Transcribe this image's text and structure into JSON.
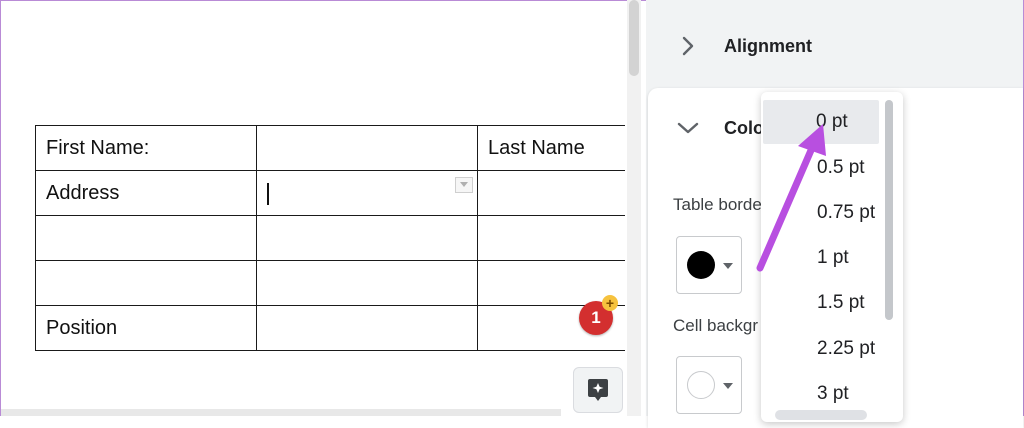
{
  "document": {
    "table": {
      "rows": [
        [
          "First Name:",
          "",
          "Last Name"
        ],
        [
          "Address",
          "",
          ""
        ],
        [
          "",
          "",
          ""
        ],
        [
          "",
          "",
          ""
        ],
        [
          "Position",
          "",
          ""
        ]
      ]
    },
    "comment_badge": {
      "count": "1",
      "plus": "+"
    }
  },
  "sidebar": {
    "alignment": {
      "title": "Alignment"
    },
    "color": {
      "title": "Colo",
      "table_border_label": "Table borde",
      "cell_background_label": "Cell backgr",
      "border_color": "#000000",
      "background_color": "#ffffff"
    }
  },
  "border_width_dropdown": {
    "selected": "0 pt",
    "options": [
      "0 pt",
      "0.5 pt",
      "0.75 pt",
      "1 pt",
      "1.5 pt",
      "2.25 pt",
      "3 pt"
    ]
  },
  "colors": {
    "annotation_arrow": "#b84fe0",
    "comment_badge": "#d32f2f",
    "panel_bg": "#f1f3f4"
  },
  "icons": [
    "chevron-right-icon",
    "chevron-down-icon",
    "cell-dropdown-icon",
    "explore-icon",
    "dropdown-caret-icon"
  ]
}
